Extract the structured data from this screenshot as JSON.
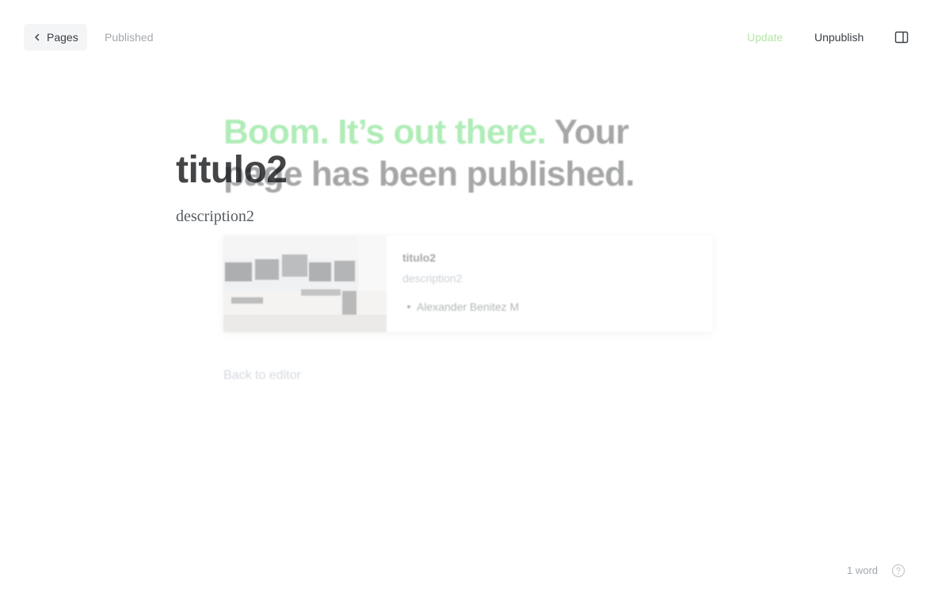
{
  "header": {
    "back_label": "Pages",
    "status": "Published",
    "update_label": "Update",
    "unpublish_label": "Unpublish"
  },
  "post": {
    "title": "titulo2",
    "excerpt": "description2"
  },
  "publish_modal": {
    "headline_accent": "Boom. It’s out there.",
    "headline_rest": "Your page has been published.",
    "card": {
      "title": "titulo2",
      "description": "description2",
      "author": "Alexander Benitez M"
    },
    "back_to_editor": "Back to editor"
  },
  "footer": {
    "word_count": "1 word"
  },
  "colors": {
    "accent_green": "#30cf43",
    "text_dark": "#15171a",
    "text_muted": "#a3a8ae"
  },
  "icons": {
    "back": "chevron-left-icon",
    "sidebar": "sidebar-toggle-icon",
    "help": "help-circle-icon"
  }
}
